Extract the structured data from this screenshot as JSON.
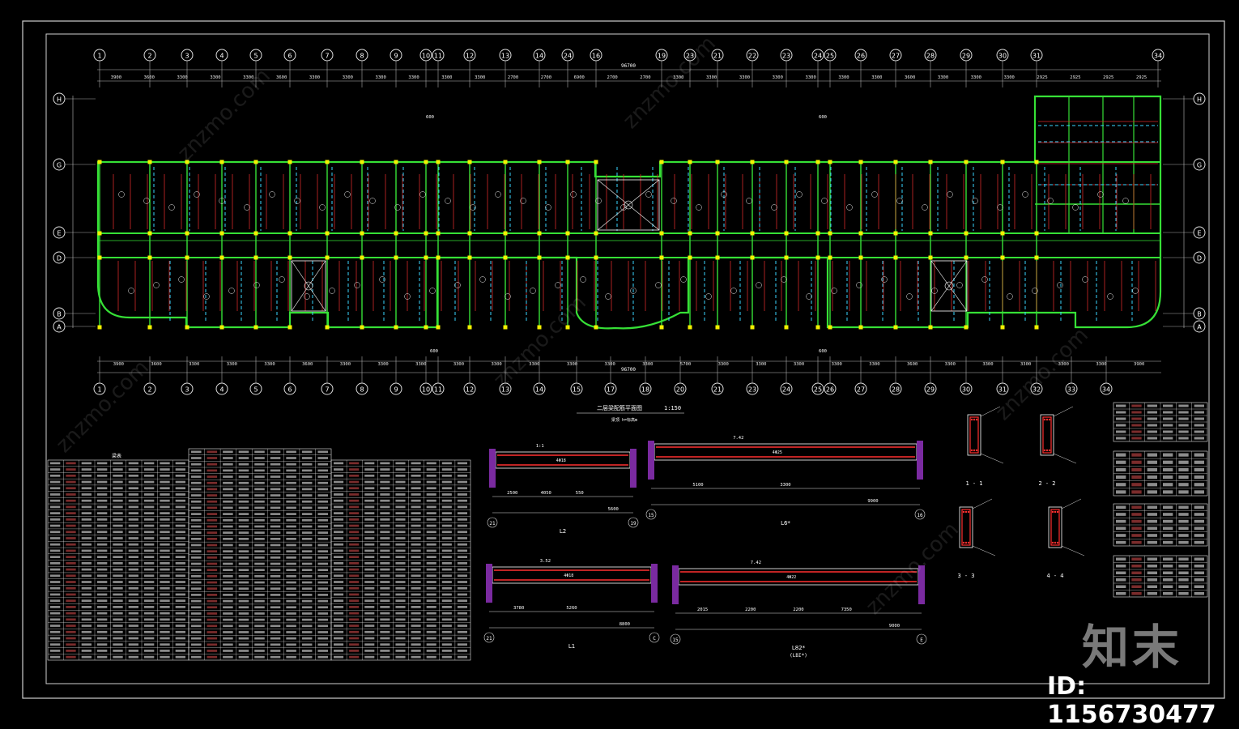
{
  "drawing": {
    "axis_numbers_top": [
      "1",
      "2",
      "3",
      "4",
      "5",
      "6",
      "7",
      "8",
      "9",
      "10",
      "11",
      "12",
      "13",
      "14",
      "24",
      "16",
      "19",
      "23",
      "21",
      "22",
      "23",
      "24",
      "25",
      "26",
      "27",
      "28",
      "29",
      "30",
      "31",
      "34"
    ],
    "axis_numbers_bottom": [
      "1",
      "2",
      "3",
      "4",
      "5",
      "6",
      "7",
      "8",
      "9",
      "10",
      "11",
      "12",
      "13",
      "14",
      "15",
      "17",
      "18",
      "20",
      "21",
      "23",
      "24",
      "25",
      "26",
      "27",
      "28",
      "29",
      "30",
      "31",
      "32",
      "33",
      "34"
    ],
    "axis_letters": [
      "H",
      "G",
      "E",
      "D",
      "B",
      "A"
    ],
    "bays_top": [
      "3900",
      "3600",
      "3300",
      "3300",
      "3300",
      "3600",
      "3300",
      "3300",
      "3300",
      "3300",
      "3300",
      "3300",
      "2700",
      "2700",
      "6900",
      "2700",
      "2700",
      "3300",
      "3300",
      "3300",
      "3300",
      "3300",
      "3300",
      "3300",
      "3600",
      "3300",
      "3300",
      "3300",
      "2925",
      "2925",
      "2925",
      "2925"
    ],
    "bays_bottom": [
      "3900",
      "3600",
      "3300",
      "3300",
      "3300",
      "3600",
      "3300",
      "3300",
      "3300",
      "3300",
      "3300",
      "3300",
      "3300",
      "3300",
      "3300",
      "5700",
      "3300",
      "3300",
      "3300",
      "3300",
      "3300",
      "3600",
      "3300",
      "3300",
      "3300",
      "3300",
      "3300",
      "3900"
    ],
    "total_top": "96700",
    "total_bottom": "96700",
    "mid_dim": "600",
    "plan_title": "二层梁配筋平面图",
    "plan_scale": "1:150",
    "plan_note": "梁顶 h=标高m",
    "table_title": "梁表",
    "details": {
      "L2": {
        "label": "L2",
        "dims": [
          "2500",
          "4050",
          "550",
          "5600"
        ],
        "axes": [
          "21",
          "19"
        ],
        "top": "1:1",
        "rebar": "4Φ18"
      },
      "L6": {
        "label": "L6*",
        "dims": [
          "5100",
          "3300",
          "9900"
        ],
        "axes": [
          "15",
          "16"
        ],
        "top": "7.42",
        "rebar": "4Φ25"
      },
      "L1": {
        "label": "L1",
        "dims": [
          "3780",
          "5260",
          "8800"
        ],
        "axes": [
          "21",
          "C"
        ],
        "top": "3.52",
        "rebar": "4Φ18"
      },
      "L8": {
        "label": "L82*",
        "sub": "(LBI*)",
        "dims": [
          "2015",
          "2200",
          "2200",
          "7350",
          "9000"
        ],
        "axes": [
          "15",
          "E"
        ],
        "top": "7.42",
        "rebar": "4Φ22"
      },
      "sections": [
        "1 - 1",
        "2 - 2",
        "3 - 3",
        "4 - 4"
      ]
    }
  },
  "watermark": {
    "logo": "知末",
    "id": "ID: 1156730477",
    "site": "znzmo.com"
  }
}
